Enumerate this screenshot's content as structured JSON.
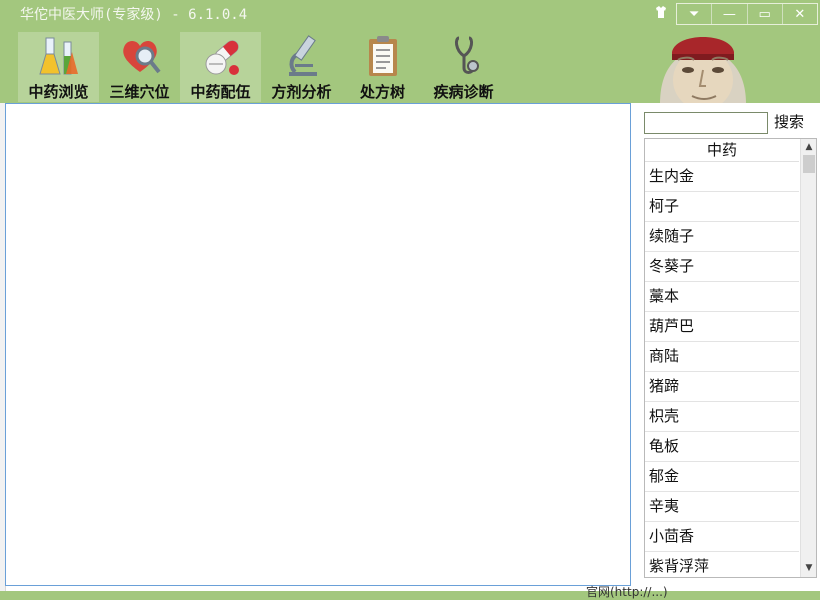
{
  "window": {
    "title": "华佗中医大师(专家级) - 6.1.0.4",
    "buttons": [
      {
        "name": "menu-dropdown",
        "glyph": "⏷"
      },
      {
        "name": "minimize",
        "glyph": "—"
      },
      {
        "name": "maximize",
        "glyph": "▭"
      },
      {
        "name": "close",
        "glyph": "✕"
      }
    ]
  },
  "toolbar": {
    "items": [
      {
        "label": "中药浏览",
        "icon": "flask-icon",
        "active": true
      },
      {
        "label": "三维穴位",
        "icon": "heart-magnifier-icon",
        "active": false
      },
      {
        "label": "中药配伍",
        "icon": "pills-icon",
        "active": true
      },
      {
        "label": "方剂分析",
        "icon": "microscope-icon",
        "active": false
      },
      {
        "label": "处方树",
        "icon": "clipboard-icon",
        "active": false
      },
      {
        "label": "疾病诊断",
        "icon": "stethoscope-icon",
        "active": false
      }
    ]
  },
  "search": {
    "value": "",
    "button_label": "搜索"
  },
  "herb_list": {
    "header": "中药",
    "items": [
      "生内金",
      "柯子",
      "续随子",
      "冬葵子",
      "藁本",
      "葫芦巴",
      "商陆",
      "猪蹄",
      "枳壳",
      "龟板",
      "郁金",
      "辛夷",
      "小茴香",
      "紫背浮萍"
    ]
  },
  "status": {
    "text": "官网(http://...)"
  },
  "colors": {
    "chrome": "#a3c77e",
    "active_tool": "#b7d39a",
    "panel_border": "#6aa0d8"
  }
}
